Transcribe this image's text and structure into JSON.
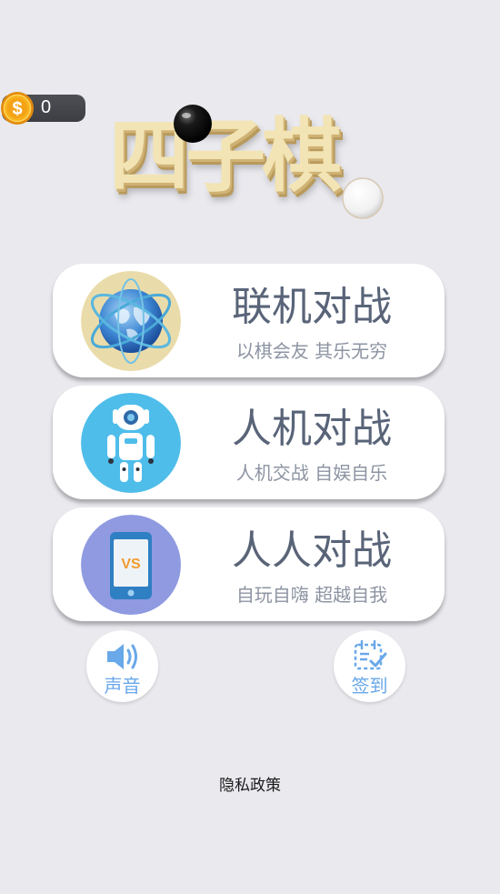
{
  "wallet": {
    "coin_icon": "dollar-coin-icon",
    "coin_count": "0"
  },
  "title": {
    "text": "四子棋"
  },
  "modes": [
    {
      "title": "联机对战",
      "subtitle": "以棋会友  其乐无穷",
      "icon": "globe-icon"
    },
    {
      "title": "人机对战",
      "subtitle": "人机交战  自娱自乐",
      "icon": "robot-icon"
    },
    {
      "title": "人人对战",
      "subtitle": "自玩自嗨  超越自我",
      "icon": "phone-vs-icon",
      "badge_text": "VS"
    }
  ],
  "controls": {
    "sound_label": "声音",
    "sound_icon": "speaker-icon",
    "checkin_label": "签到",
    "checkin_icon": "calendar-check-icon"
  },
  "footer": {
    "privacy_label": "隐私政策"
  },
  "colors": {
    "background": "#e9e9ee",
    "card": "#ffffff",
    "mode_title": "#596478",
    "mode_subtitle": "#8d94a2",
    "button_label": "#69a8e9",
    "title_gold": "#f2e4b4"
  }
}
